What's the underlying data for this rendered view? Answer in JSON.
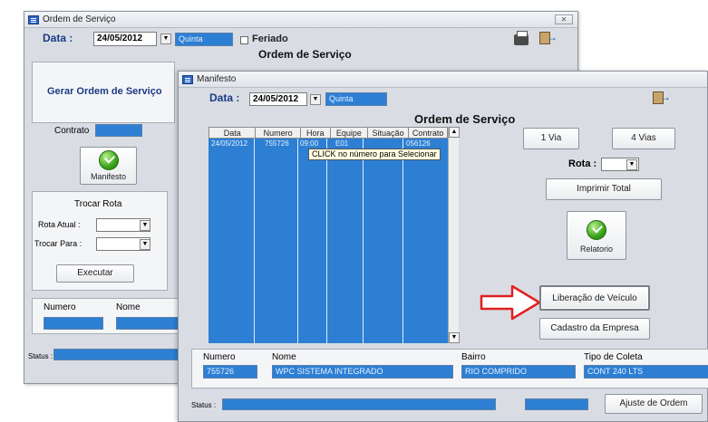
{
  "back_window": {
    "title": "Ordem de Serviço",
    "data_label": "Data :",
    "data_value": "24/05/2012",
    "weekday": "Quinta",
    "feriado_label": "Feriado",
    "heading": "Ordem de Serviço",
    "gerar_button": "Gerar Ordem de Serviço",
    "contrato_label": "Contrato",
    "manifesto_button": "Manifesto",
    "trocar_rota_title": "Trocar Rota",
    "rota_atual_label": "Rota Atual :",
    "trocar_para_label": "Trocar Para :",
    "executar_button": "Executar",
    "numero_label": "Numero",
    "nome_label": "Nome",
    "status_label": "Status :"
  },
  "front_window": {
    "title": "Manifesto",
    "data_label": "Data :",
    "data_value": "24/05/2012",
    "weekday": "Quinta",
    "heading": "Ordem de Serviço",
    "grid": {
      "columns": [
        "Data",
        "Numero",
        "Hora",
        "Equipe",
        "Situação",
        "Contrato"
      ],
      "rows": [
        [
          "24/05/2012",
          "755726",
          "09:00",
          "E01",
          "",
          "056126"
        ]
      ],
      "tooltip": "CLICK no número para Selecionar"
    },
    "via1_button": "1 Via",
    "via4_button": "4 Vias",
    "rota_label": "Rota :",
    "imprimir_button": "Imprimir Total",
    "relatorio_button": "Relatorio",
    "liberacao_button": "Liberação de Veículo",
    "cadastro_button": "Cadastro da Empresa",
    "bottom": {
      "numero_label": "Numero",
      "numero_value": "755726",
      "nome_label": "Nome",
      "nome_value": "WPC SISTEMA INTEGRADO",
      "bairro_label": "Bairro",
      "bairro_value": "RIO COMPRIDO",
      "tipo_label": "Tipo de Coleta",
      "tipo_value": "CONT 240 LTS"
    },
    "status_label": "Status :",
    "ajuste_button": "Ajuste de Ordem"
  },
  "colors": {
    "field_blue": "#2d7fd3",
    "window_bg": "#d9dde3",
    "annotation_arrow": "#e02020"
  },
  "icons": [
    "window-app-icon",
    "printer-icon",
    "exit-icon",
    "check-icon",
    "dropdown-arrow-icon",
    "red-arrow-annotation"
  ]
}
